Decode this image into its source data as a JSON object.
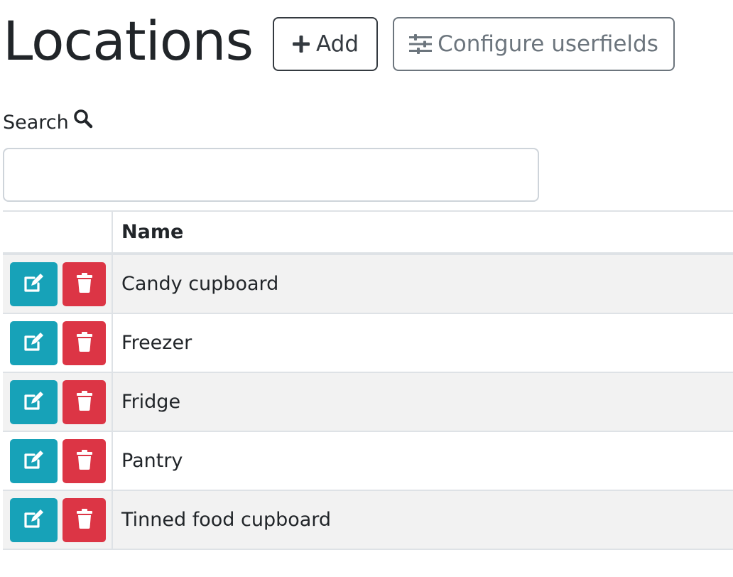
{
  "header": {
    "title": "Locations",
    "add_label": "Add",
    "configure_label": "Configure userfields"
  },
  "search": {
    "label": "Search",
    "value": "",
    "placeholder": ""
  },
  "table": {
    "columns": [
      "",
      "Name"
    ],
    "rows": [
      {
        "name": "Candy cupboard"
      },
      {
        "name": "Freezer"
      },
      {
        "name": "Fridge"
      },
      {
        "name": "Pantry"
      },
      {
        "name": "Tinned food cupboard"
      }
    ]
  },
  "colors": {
    "edit": "#17a2b8",
    "delete": "#dc3545",
    "stripe": "#f2f2f2"
  },
  "icons": {
    "add": "plus-icon",
    "configure": "sliders-icon",
    "search": "search-icon",
    "edit": "edit-icon",
    "delete": "trash-icon"
  }
}
